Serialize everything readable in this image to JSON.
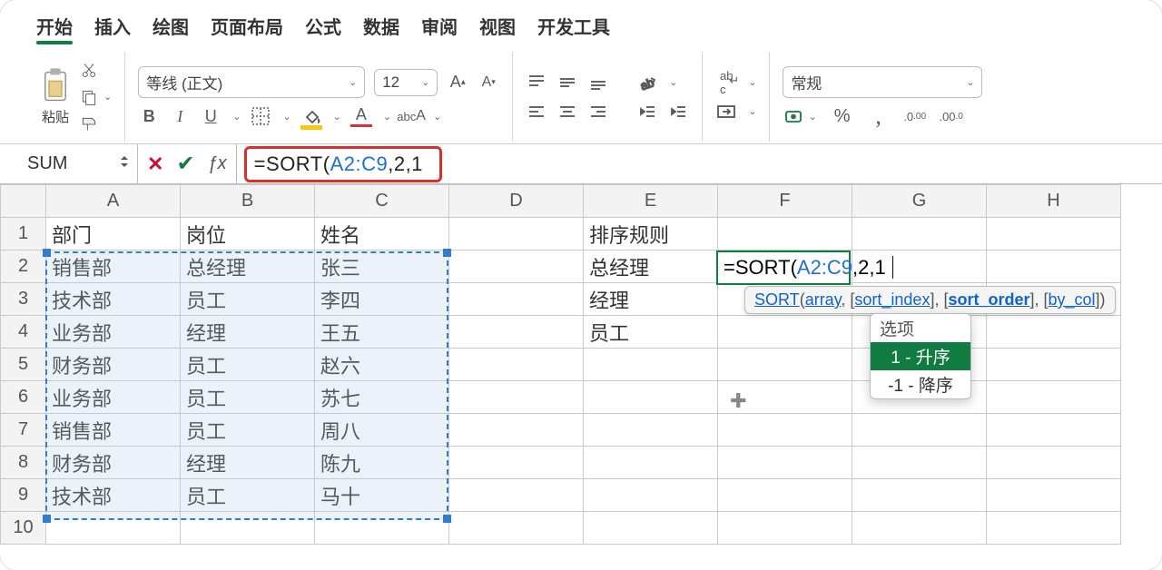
{
  "tabs": [
    "开始",
    "插入",
    "绘图",
    "页面布局",
    "公式",
    "数据",
    "审阅",
    "视图",
    "开发工具"
  ],
  "active_tab_index": 0,
  "clipboard": {
    "paste_label": "粘贴"
  },
  "font": {
    "name": "等线 (正文)",
    "size": "12"
  },
  "number_format": {
    "label": "常规"
  },
  "name_box": "SUM",
  "formula": {
    "prefix": "=SORT(",
    "range": "A2:C9",
    "suffix": ",2,1"
  },
  "columns": [
    "A",
    "B",
    "C",
    "D",
    "E",
    "F",
    "G",
    "H"
  ],
  "row_numbers": [
    1,
    2,
    3,
    4,
    5,
    6,
    7,
    8,
    9,
    10
  ],
  "cells": {
    "A1": "部门",
    "B1": "岗位",
    "C1": "姓名",
    "E1": "排序规则",
    "A2": "销售部",
    "B2": "总经理",
    "C2": "张三",
    "E2": "总经理",
    "A3": "技术部",
    "B3": "员工",
    "C3": "李四",
    "E3": "经理",
    "A4": "业务部",
    "B4": "经理",
    "C4": "王五",
    "E4": "员工",
    "A5": "财务部",
    "B5": "员工",
    "C5": "赵六",
    "A6": "业务部",
    "B6": "员工",
    "C6": "苏七",
    "A7": "销售部",
    "B7": "员工",
    "C7": "周八",
    "A8": "财务部",
    "B8": "经理",
    "C8": "陈九",
    "A9": "技术部",
    "B9": "员工",
    "C9": "马十"
  },
  "active_cell": "F2",
  "active_cell_edit": {
    "prefix": "=SORT(",
    "range": "A2:C9",
    "suffix": ",2,1"
  },
  "fn_tooltip": {
    "name": "SORT",
    "args": [
      "array",
      "[sort_index]",
      "[sort_order]",
      "[by_col]"
    ],
    "current_arg_index": 2
  },
  "sort_order_popup": {
    "header": "选项",
    "options": [
      {
        "label": "1 - 升序",
        "selected": true
      },
      {
        "label": "-1 - 降序",
        "selected": false
      }
    ]
  },
  "chart_data": null
}
